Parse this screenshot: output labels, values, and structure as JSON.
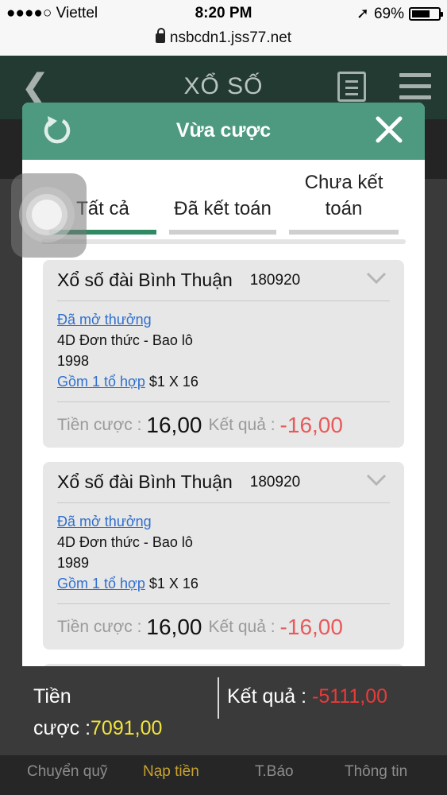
{
  "status_bar": {
    "carrier": "●●●●○ Viettel",
    "time": "8:20 PM",
    "battery": "69%",
    "battery_level": 0.69,
    "url": "nsbcdn1.jss77.net"
  },
  "app_header": {
    "back_symbol": "❮",
    "title": "XỔ SỐ"
  },
  "modal": {
    "title": "Vừa cược",
    "tabs": [
      {
        "label": "Tất cả",
        "active": true
      },
      {
        "label": "Đã kết toán",
        "active": false
      },
      {
        "label": "Chưa kết toán",
        "active": false
      }
    ],
    "cards": [
      {
        "name": "Xổ số đài Bình Thuận",
        "code": "180920",
        "status_link": "Đã mở thưởng",
        "bet_type": "4D Đơn thức - Bao lô",
        "number": "1998",
        "combo_link": "Gồm 1 tổ hợp",
        "stake_detail": "$1 X 16",
        "stake_label": "Tiền cược :",
        "stake_value": "16,00",
        "result_label": "Kết quả :",
        "result_value": "-16,00"
      },
      {
        "name": "Xổ số đài Bình Thuận",
        "code": "180920",
        "status_link": "Đã mở thưởng",
        "bet_type": "4D Đơn thức - Bao lô",
        "number": "1989",
        "combo_link": "Gồm 1 tổ hợp",
        "stake_detail": "$1 X 16",
        "stake_label": "Tiền cược :",
        "stake_value": "16,00",
        "result_label": "Kết quả :",
        "result_value": "-16,00"
      }
    ]
  },
  "summary": {
    "stake_label_line1": "Tiền",
    "stake_label_line2": "cược :",
    "stake_value": "7091,00",
    "result_label": "Kết quả :",
    "result_value": "-5111,00"
  },
  "bottom_nav": [
    {
      "label": "Chuyển quỹ",
      "active": false
    },
    {
      "label": "Nạp tiền",
      "active": true
    },
    {
      "label": "T.Báo",
      "active": false
    },
    {
      "label": "Thông tin",
      "active": false
    }
  ],
  "colors": {
    "modal_header": "#4e9a80",
    "active_tab": "#2f8a63",
    "link": "#2f6fcf",
    "negative": "#e85a5a",
    "summary_stake": "#f2e33c",
    "nav_active": "#c9a22f"
  }
}
